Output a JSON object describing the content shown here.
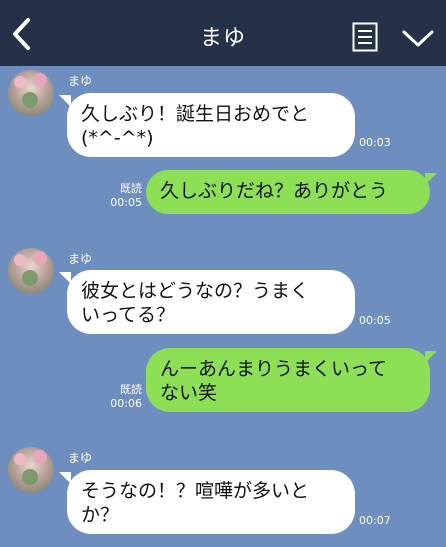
{
  "header": {
    "title": "まゆ",
    "back_icon": "chevron-left-icon",
    "menu_icon": "note-list-icon",
    "dropdown_icon": "chevron-down-icon"
  },
  "colors": {
    "header_bg": "#253049",
    "chat_bg": "#6f8ec0",
    "incoming_bubble": "#ffffff",
    "outgoing_bubble": "#8de055"
  },
  "messages": [
    {
      "direction": "in",
      "sender": "まゆ",
      "text_line1": "久しぶり！誕生日おめでと",
      "text_line2": "(*^-^*)",
      "time": "00:03"
    },
    {
      "direction": "out",
      "read": "既読",
      "text_line1": "久しぶりだね？ありがとう",
      "time": "00:05"
    },
    {
      "direction": "in",
      "sender": "まゆ",
      "text_line1": "彼女とはどうなの？うまく",
      "text_line2": "いってる？",
      "time": "00:05"
    },
    {
      "direction": "out",
      "read": "既読",
      "text_line1": "んーあんまりうまくいって",
      "text_line2": "ない笑",
      "time": "00:06"
    },
    {
      "direction": "in",
      "sender": "まゆ",
      "text_line1": "そうなの！？喧嘩が多いと",
      "text_line2": "か？",
      "time": "00:07"
    }
  ]
}
